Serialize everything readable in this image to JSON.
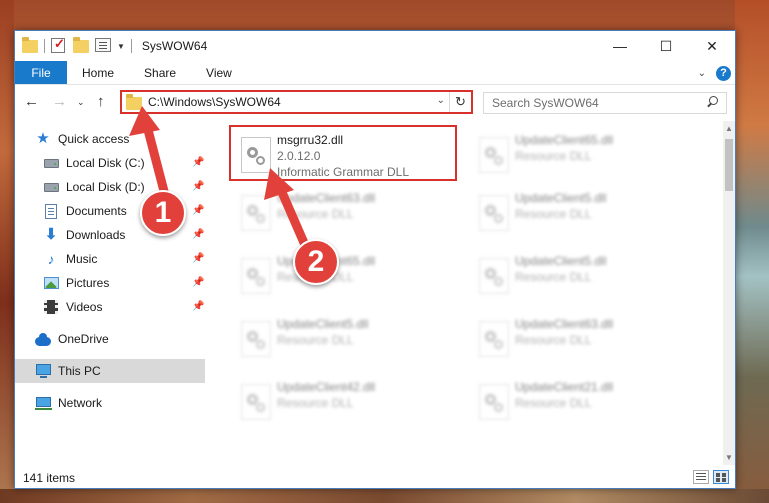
{
  "window": {
    "title": "SysWOW64",
    "controls": {
      "minimize": "—",
      "maximize": "☐",
      "close": "✕"
    }
  },
  "ribbon": {
    "tabs": [
      {
        "label": "File"
      },
      {
        "label": "Home"
      },
      {
        "label": "Share"
      },
      {
        "label": "View"
      }
    ],
    "help": "?"
  },
  "navigation": {
    "address": "C:\\Windows\\SysWOW64",
    "search_placeholder": "Search SysWOW64"
  },
  "sidebar": {
    "items": [
      {
        "label": "Quick access",
        "icon": "star-icon"
      },
      {
        "label": "Local Disk (C:)",
        "icon": "disk-icon",
        "pinned": true
      },
      {
        "label": "Local Disk (D:)",
        "icon": "disk-icon",
        "pinned": true
      },
      {
        "label": "Documents",
        "icon": "documents-icon",
        "pinned": true
      },
      {
        "label": "Downloads",
        "icon": "downloads-icon",
        "pinned": true
      },
      {
        "label": "Music",
        "icon": "music-icon",
        "pinned": true
      },
      {
        "label": "Pictures",
        "icon": "pictures-icon",
        "pinned": true
      },
      {
        "label": "Videos",
        "icon": "videos-icon",
        "pinned": true
      },
      {
        "label": "OneDrive",
        "icon": "onedrive-icon"
      },
      {
        "label": "This PC",
        "icon": "this-pc-icon",
        "selected": true
      },
      {
        "label": "Network",
        "icon": "network-icon"
      }
    ]
  },
  "files": [
    {
      "name": "msgrru32.dll",
      "line2": "2.0.12.0",
      "line3": "Informatic Grammar DLL",
      "highlighted": true
    },
    {
      "name": "UpdateClient65.dll",
      "line2": "Resource DLL"
    },
    {
      "name": "UpdateClient63.dll",
      "line2": "Resource DLL"
    },
    {
      "name": "UpdateClient5.dll",
      "line2": "Resource DLL"
    },
    {
      "name": "UpdateClient65.dll",
      "line2": "Resource DLL"
    },
    {
      "name": "UpdateClient5.dll",
      "line2": "Resource DLL"
    },
    {
      "name": "UpdateClient5.dll",
      "line2": "Resource DLL"
    },
    {
      "name": "UpdateClient63.dll",
      "line2": "Resource DLL"
    },
    {
      "name": "UpdateClient42.dll",
      "line2": "Resource DLL"
    },
    {
      "name": "UpdateClient21.dll",
      "line2": "Resource DLL"
    }
  ],
  "status": {
    "item_count": "141 items"
  },
  "annotations": [
    {
      "number": "1",
      "color": "#e2413b"
    },
    {
      "number": "2",
      "color": "#e2413b"
    }
  ],
  "colors": {
    "accent": "#1979ca",
    "highlight": "#d9302c"
  }
}
